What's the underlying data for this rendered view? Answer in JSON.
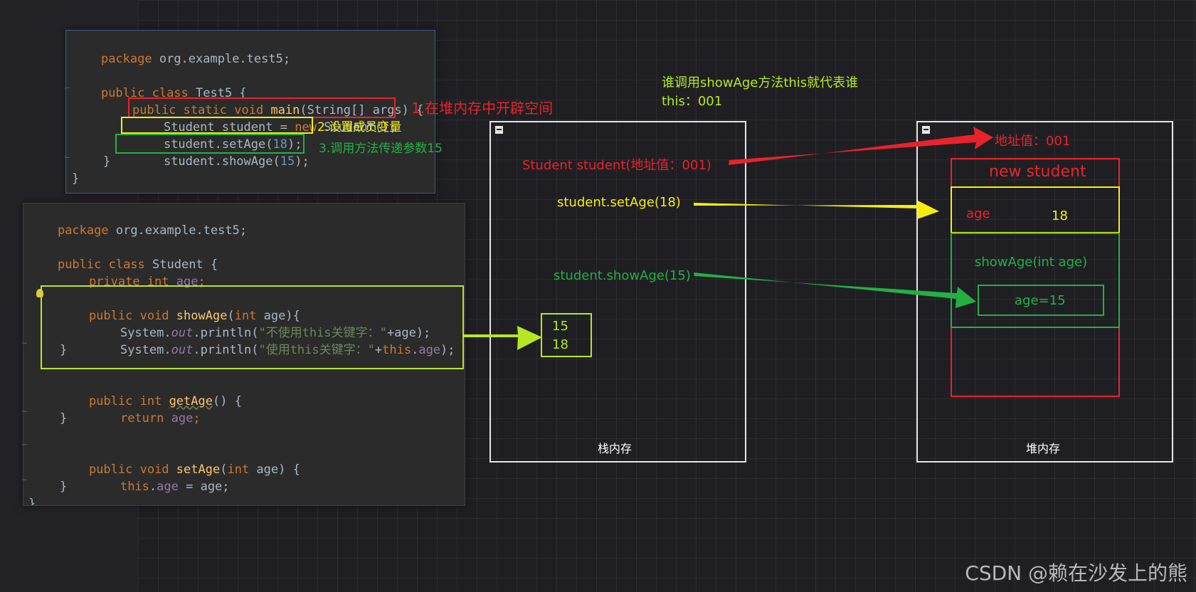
{
  "code_test5": {
    "l1_kw": "package",
    "l1_rest": " org.example.test5;",
    "l3_kw": "public class",
    "l3_rest": " Test5 {",
    "l4_kw": "public static void",
    "l4_fn": "main",
    "l4_rest": "(String[] args) {",
    "l5_a": "Student student = ",
    "l5_kw": "new",
    "l5_b": " Student();",
    "l6_a": "student.setAge(",
    "l6_num": "18",
    "l6_b": ");",
    "l7_a": "student.showAge(",
    "l7_num": "15",
    "l7_b": ");",
    "l8": "}",
    "l9": "}"
  },
  "code_student": {
    "l1_kw": "package",
    "l1_rest": " org.example.test5;",
    "l3_kw": "public class",
    "l3_rest": " Student {",
    "l4_kw": "private int",
    "l4_field": "age",
    "l4_end": ";",
    "l6_kw": "public void",
    "l6_fn": "showAge",
    "l6_p": "(",
    "l6_kw2": "int",
    "l6_arg": " age",
    "l6_end": "){",
    "l7_a": "System.",
    "l7_out": "out",
    "l7_b": ".println(",
    "l7_str": "\"不使用this关键字：\"",
    "l7_c": "+age);",
    "l8_a": "System.",
    "l8_out": "out",
    "l8_b": ".println(",
    "l8_str": "\"使用this关键字：\"",
    "l8_plus": "+",
    "l8_this": "this",
    "l8_dot": ".",
    "l8_field": "age",
    "l8_end": ");",
    "l9": "}",
    "l11_kw": "public int",
    "l11_fn": "getAge",
    "l11_rest": "() {",
    "l12_kw": "return",
    "l12_field": "age",
    "l12_end": ";",
    "l13": "}",
    "l15_kw": "public void",
    "l15_fn": "setAge",
    "l15_p": "(",
    "l15_kw2": "int",
    "l15_rest": " age) {",
    "l16_kw": "this",
    "l16_dot": ".",
    "l16_field": "age",
    "l16_rest": " = age;",
    "l17": "}",
    "l18": "}"
  },
  "annotations": {
    "note1": "1.在堆内存中开辟空间",
    "note2": "2.设置成员变量",
    "note3": "3.调用方法传递参数15",
    "top_line1": "谁调用showAge方法this就代表谁",
    "top_line2": "this：001"
  },
  "stack": {
    "label": "栈内存",
    "student_ref": "Student student(地址值：001)",
    "set_age": "student.setAge(18)",
    "show_age": "student.showAge(15)",
    "output_1": "15",
    "output_2": "18"
  },
  "heap": {
    "label": "堆内存",
    "address": "地址值：001",
    "object_title": "new student",
    "field_name": "age",
    "field_value": "18",
    "method": "showAge(int age)",
    "param": "age=15"
  },
  "watermark": "CSDN @赖在沙发上的熊",
  "colors": {
    "red": "#e8232b",
    "yellow": "#f7ee0f",
    "green": "#23b043",
    "lime": "#b8e623",
    "grid_bg": "#1f1f23",
    "code_bg": "#2b2b2b"
  }
}
